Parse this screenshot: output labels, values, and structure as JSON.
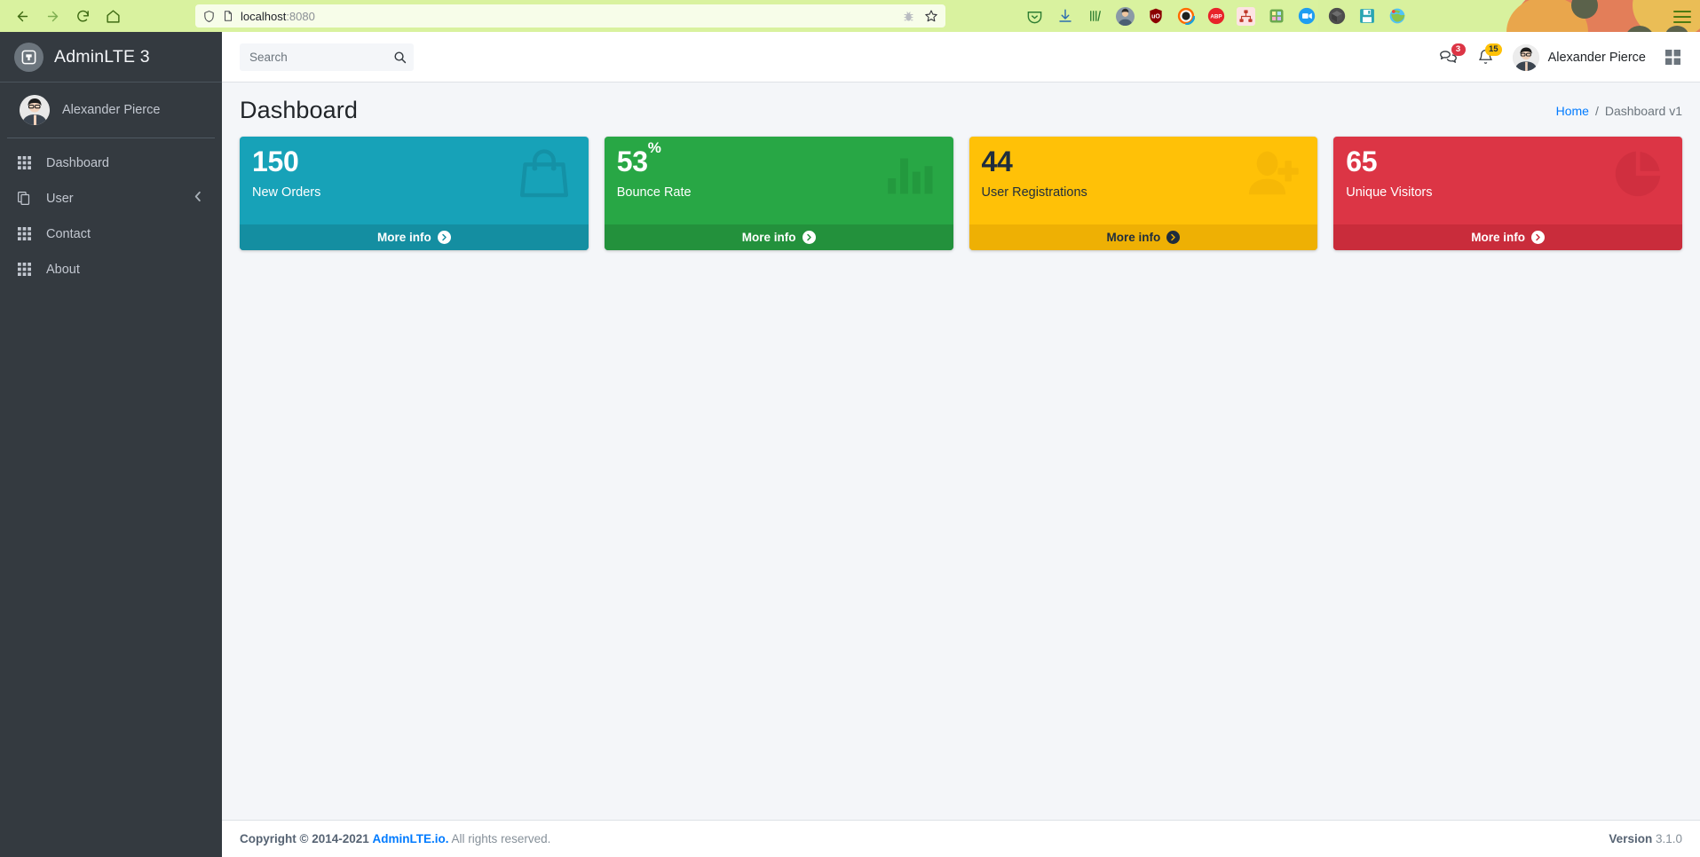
{
  "browser": {
    "back_label": "Back",
    "forward_label": "Forward",
    "reload_label": "Reload",
    "home_label": "Home",
    "url_host": "localhost",
    "url_port": ":8080",
    "shield_icon": "shield-icon",
    "page_icon": "page-icon",
    "reader_icon": "bug-icon",
    "bookmark_icon": "star-icon",
    "menu_icon": "hamburger-menu-icon",
    "extensions": [
      {
        "name": "pocket-extension-icon",
        "glyph": "",
        "color": "#d9f29f",
        "text_color": "#2e7d32"
      },
      {
        "name": "downloads-icon",
        "glyph": "",
        "color": "#d9f29f",
        "text_color": "#1565c0"
      },
      {
        "name": "library-icon",
        "glyph": "",
        "color": "#d9f29f",
        "text_color": "#2e7d32"
      },
      {
        "name": "account-avatar-icon",
        "glyph": "",
        "color": "#6b7f8c",
        "text_color": "#ffffff"
      },
      {
        "name": "ublock-origin-icon",
        "glyph": "uO",
        "color": "#8b0000",
        "text_color": "#ffffff"
      },
      {
        "name": "camera-extension-icon",
        "glyph": "",
        "color": "#ffffff",
        "text_color": "#000000"
      },
      {
        "name": "adblock-plus-icon",
        "glyph": "ABP",
        "color": "#e8232a",
        "text_color": "#ffffff"
      },
      {
        "name": "sitemap-extension-icon",
        "glyph": "",
        "color": "#ffe0e0",
        "text_color": "#c0392b"
      },
      {
        "name": "puzzle-extension-icon",
        "glyph": "",
        "color": "#7cb342",
        "text_color": "#ffffff"
      },
      {
        "name": "video-recorder-icon",
        "glyph": "",
        "color": "#1e9df1",
        "text_color": "#ffffff"
      },
      {
        "name": "cube-extension-icon",
        "glyph": "",
        "color": "#555555",
        "text_color": "#ffffff"
      },
      {
        "name": "save-extension-icon",
        "glyph": "",
        "color": "#2aa5b3",
        "text_color": "#ffffff"
      },
      {
        "name": "globe-extension-icon",
        "glyph": "",
        "color": "#8bc34a",
        "text_color": "#ffffff"
      }
    ]
  },
  "sidebar": {
    "brand_title": "AdminLTE 3",
    "brand_logo_icon": "adminlte-logo-icon",
    "user_name": "Alexander Pierce",
    "user_avatar_icon": "avatar",
    "items": [
      {
        "label": "Dashboard",
        "icon": "grid-icon",
        "has_arrow": false
      },
      {
        "label": "User",
        "icon": "copy-file-icon",
        "has_arrow": true,
        "arrow_icon": "chevron-left-icon"
      },
      {
        "label": "Contact",
        "icon": "grid-icon",
        "has_arrow": false
      },
      {
        "label": "About",
        "icon": "grid-icon",
        "has_arrow": false
      }
    ]
  },
  "navbar": {
    "search_placeholder": "Search",
    "search_value": "",
    "search_icon": "search-icon",
    "messages": {
      "icon": "comments-icon",
      "badge": "3",
      "badge_color": "#dc3545"
    },
    "notifications": {
      "icon": "bell-icon",
      "badge": "15",
      "badge_color": "#ffc107",
      "badge_text_color": "#1f2d3d"
    },
    "user_name": "Alexander Pierce",
    "user_avatar_icon": "avatar",
    "grid_icon": "th-large-icon"
  },
  "content_header": {
    "title": "Dashboard",
    "breadcrumb": {
      "home": "Home",
      "separator": "/",
      "current": "Dashboard v1"
    }
  },
  "boxes": [
    {
      "number": "150",
      "suffix": "",
      "label": "New Orders",
      "more_info": "More info",
      "icon": "shopping-bag-icon",
      "bg": "#17a2b8",
      "footer_bg": "#148ea1",
      "text_color": "#ffffff",
      "arrow_bg": "#ffffff",
      "arrow_color": "#148ea1"
    },
    {
      "number": "53",
      "suffix": "%",
      "label": "Bounce Rate",
      "more_info": "More info",
      "icon": "bar-chart-icon",
      "bg": "#28a745",
      "footer_bg": "#23913c",
      "text_color": "#ffffff",
      "arrow_bg": "#ffffff",
      "arrow_color": "#23913c"
    },
    {
      "number": "44",
      "suffix": "",
      "label": "User Registrations",
      "more_info": "More info",
      "icon": "user-plus-icon",
      "bg": "#ffc107",
      "footer_bg": "#eeb004",
      "text_color": "#1f2d3d",
      "arrow_bg": "#1f2d3d",
      "arrow_color": "#eeb004"
    },
    {
      "number": "65",
      "suffix": "",
      "label": "Unique Visitors",
      "more_info": "More info",
      "icon": "pie-chart-icon",
      "bg": "#dc3545",
      "footer_bg": "#c92c3b",
      "text_color": "#ffffff",
      "arrow_bg": "#ffffff",
      "arrow_color": "#c92c3b"
    }
  ],
  "footer": {
    "copyright_prefix": "Copyright © 2014-2021",
    "brand_link": "AdminLTE.io.",
    "rights": "All rights reserved.",
    "version_label": "Version",
    "version_number": "3.1.0"
  }
}
